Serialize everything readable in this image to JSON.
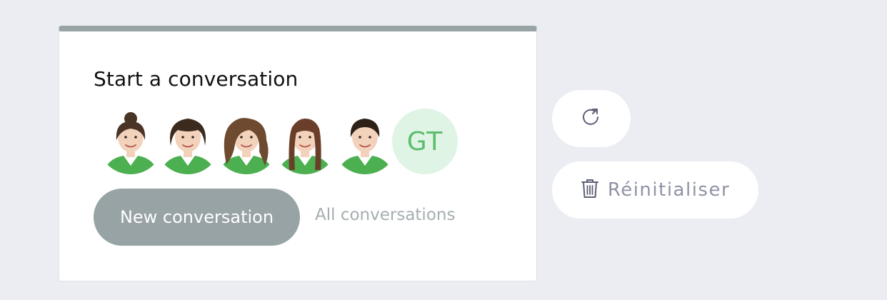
{
  "widget": {
    "title": "Start a conversation",
    "agents": [
      {
        "name": "agent-1",
        "kind": "illustration",
        "hair": "#4a3426",
        "style": "bun"
      },
      {
        "name": "agent-2",
        "kind": "illustration",
        "hair": "#3b2b1e",
        "style": "curly-short"
      },
      {
        "name": "agent-3",
        "kind": "illustration",
        "hair": "#6e4a30",
        "style": "curly-long"
      },
      {
        "name": "agent-4",
        "kind": "illustration",
        "hair": "#6a3f2a",
        "style": "long-straight"
      },
      {
        "name": "agent-5",
        "kind": "illustration",
        "hair": "#2e2118",
        "style": "short"
      }
    ],
    "initials": "GT",
    "new_conversation_label": "New conversation",
    "all_conversations_label": "All conversations"
  },
  "side_actions": {
    "refresh_icon": "refresh-icon",
    "reset_icon": "trash-icon",
    "reset_label": "Réinitialiser"
  },
  "colors": {
    "page_bg": "#ecedf2",
    "accent_gray": "#98a3a6",
    "initials_bg": "#dff4e4",
    "initials_text": "#5cbd6c",
    "shirt_green": "#4caf50",
    "reset_text": "#8f93a6"
  }
}
